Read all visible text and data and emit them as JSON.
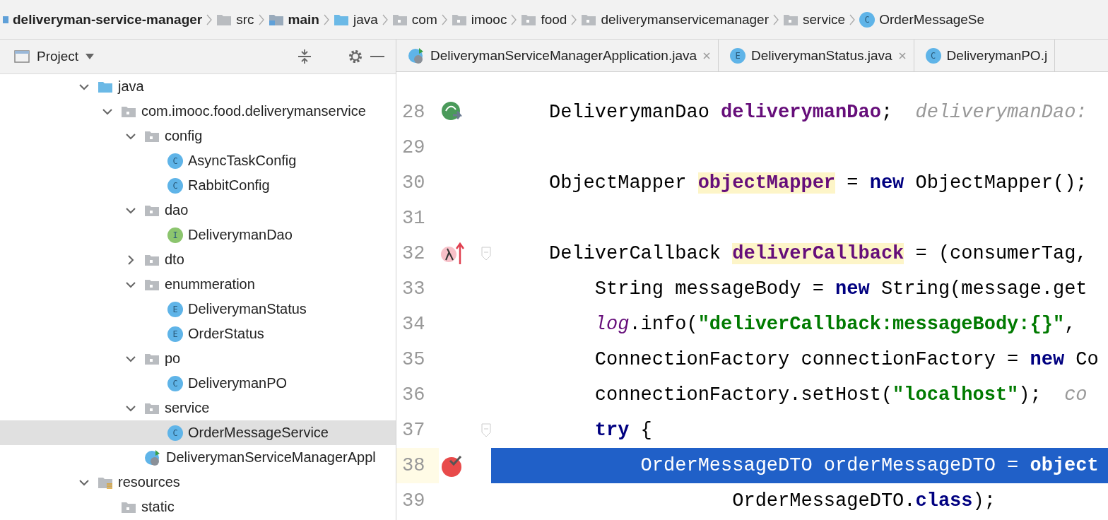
{
  "breadcrumb": [
    {
      "label": "deliveryman-service-manager",
      "kind": "module"
    },
    {
      "label": "src",
      "kind": "folder"
    },
    {
      "label": "main",
      "kind": "source-root"
    },
    {
      "label": "java",
      "kind": "java-folder"
    },
    {
      "label": "com",
      "kind": "package"
    },
    {
      "label": "imooc",
      "kind": "package"
    },
    {
      "label": "food",
      "kind": "package"
    },
    {
      "label": "deliverymanservicemanager",
      "kind": "package"
    },
    {
      "label": "service",
      "kind": "package"
    },
    {
      "label": "OrderMessageSe",
      "kind": "class",
      "badge": "C"
    }
  ],
  "project_panel": {
    "title": "Project",
    "tree": [
      {
        "label": "java",
        "kind": "java-folder",
        "expanded": true,
        "selected": false,
        "children": [
          {
            "label": "com.imooc.food.deliverymanservice",
            "kind": "package",
            "expanded": true,
            "selected": false,
            "children": [
              {
                "label": "config",
                "kind": "package",
                "expanded": true,
                "selected": false,
                "children": [
                  {
                    "label": "AsyncTaskConfig",
                    "kind": "class",
                    "badge": "C",
                    "selected": false
                  },
                  {
                    "label": "RabbitConfig",
                    "kind": "class",
                    "badge": "C",
                    "selected": false
                  }
                ]
              },
              {
                "label": "dao",
                "kind": "package",
                "expanded": true,
                "selected": false,
                "children": [
                  {
                    "label": "DeliverymanDao",
                    "kind": "interface",
                    "badge": "I",
                    "selected": false
                  }
                ]
              },
              {
                "label": "dto",
                "kind": "package",
                "expanded": false,
                "selected": false
              },
              {
                "label": "enummeration",
                "kind": "package",
                "expanded": true,
                "selected": false,
                "children": [
                  {
                    "label": "DeliverymanStatus",
                    "kind": "enum",
                    "badge": "E",
                    "selected": false
                  },
                  {
                    "label": "OrderStatus",
                    "kind": "enum",
                    "badge": "E",
                    "selected": false
                  }
                ]
              },
              {
                "label": "po",
                "kind": "package",
                "expanded": true,
                "selected": false,
                "children": [
                  {
                    "label": "DeliverymanPO",
                    "kind": "class",
                    "badge": "C",
                    "selected": false
                  }
                ]
              },
              {
                "label": "service",
                "kind": "package",
                "expanded": true,
                "selected": false,
                "children": [
                  {
                    "label": "OrderMessageService",
                    "kind": "class",
                    "badge": "C",
                    "selected": true
                  }
                ]
              },
              {
                "label": "DeliverymanServiceManagerAppl",
                "kind": "app",
                "selected": false
              }
            ]
          }
        ]
      },
      {
        "label": "resources",
        "kind": "resources",
        "expanded": true,
        "selected": false,
        "children": [
          {
            "label": "static",
            "kind": "package",
            "selected": false
          }
        ]
      }
    ]
  },
  "editor_tabs": [
    {
      "label": "DeliverymanServiceManagerApplication.java",
      "kind": "app",
      "selected": false,
      "closable": true
    },
    {
      "label": "DeliverymanStatus.java",
      "kind": "enum",
      "badge": "E",
      "selected": false,
      "closable": true
    },
    {
      "label": "DeliverymanPO.j",
      "kind": "class",
      "badge": "C",
      "selected": false,
      "closable": false
    }
  ],
  "code_lines": [
    {
      "number": "28",
      "gutter": {
        "kind": "bean"
      },
      "selected": false,
      "tokens": [
        {
          "text": "DeliverymanDao ",
          "kind": "plain"
        },
        {
          "text": "deliverymanDao",
          "kind": "field"
        },
        {
          "text": ";  ",
          "kind": "plain"
        },
        {
          "text": "deliverymanDao:",
          "kind": "hint"
        }
      ]
    },
    {
      "number": "29",
      "selected": false
    },
    {
      "number": "30",
      "selected": false,
      "tokens": [
        {
          "text": "ObjectMapper ",
          "kind": "plain"
        },
        {
          "text": "objectMapper",
          "kind": "field-decl"
        },
        {
          "text": " = ",
          "kind": "plain"
        },
        {
          "text": "new",
          "kind": "keyword"
        },
        {
          "text": " ObjectMapper();",
          "kind": "plain"
        }
      ]
    },
    {
      "number": "31",
      "selected": false
    },
    {
      "number": "32",
      "gutter": {
        "kind": "lambda"
      },
      "fold": true,
      "selected": false,
      "tokens": [
        {
          "text": "DeliverCallback ",
          "kind": "plain"
        },
        {
          "text": "deliverCallback",
          "kind": "field-decl"
        },
        {
          "text": " = (consumerTag,",
          "kind": "plain"
        }
      ]
    },
    {
      "number": "33",
      "selected": false,
      "tokens": [
        {
          "text": "    String messageBody = ",
          "kind": "plain"
        },
        {
          "text": "new",
          "kind": "keyword"
        },
        {
          "text": " String(message.get",
          "kind": "plain"
        }
      ]
    },
    {
      "number": "34",
      "selected": false,
      "tokens": [
        {
          "text": "    log",
          "kind": "static"
        },
        {
          "text": ".info(",
          "kind": "plain"
        },
        {
          "text": "\"deliverCallback:messageBody:{}\"",
          "kind": "string"
        },
        {
          "text": ",",
          "kind": "plain"
        }
      ]
    },
    {
      "number": "35",
      "selected": false,
      "tokens": [
        {
          "text": "    ConnectionFactory connectionFactory = ",
          "kind": "plain"
        },
        {
          "text": "new",
          "kind": "keyword"
        },
        {
          "text": " Co",
          "kind": "plain"
        }
      ]
    },
    {
      "number": "36",
      "selected": false,
      "tokens": [
        {
          "text": "    connectionFactory.setHost(",
          "kind": "plain"
        },
        {
          "text": "\"localhost\"",
          "kind": "string"
        },
        {
          "text": ");  ",
          "kind": "plain"
        },
        {
          "text": "co",
          "kind": "hint"
        }
      ]
    },
    {
      "number": "37",
      "fold": true,
      "selected": false,
      "tokens": [
        {
          "text": "    try",
          "kind": "keyword"
        },
        {
          "text": " {",
          "kind": "plain"
        }
      ]
    },
    {
      "number": "38",
      "gutter": {
        "kind": "breakpoint"
      },
      "selected": true,
      "tokens": [
        {
          "text": "        OrderMessageDTO orderMessageDTO = ",
          "kind": "plain"
        },
        {
          "text": "object",
          "kind": "keyword"
        }
      ]
    },
    {
      "number": "39",
      "selected": false,
      "tokens": [
        {
          "text": "                OrderMessageDTO.",
          "kind": "plain"
        },
        {
          "text": "class",
          "kind": "keyword"
        },
        {
          "text": ");",
          "kind": "plain"
        }
      ]
    }
  ]
}
